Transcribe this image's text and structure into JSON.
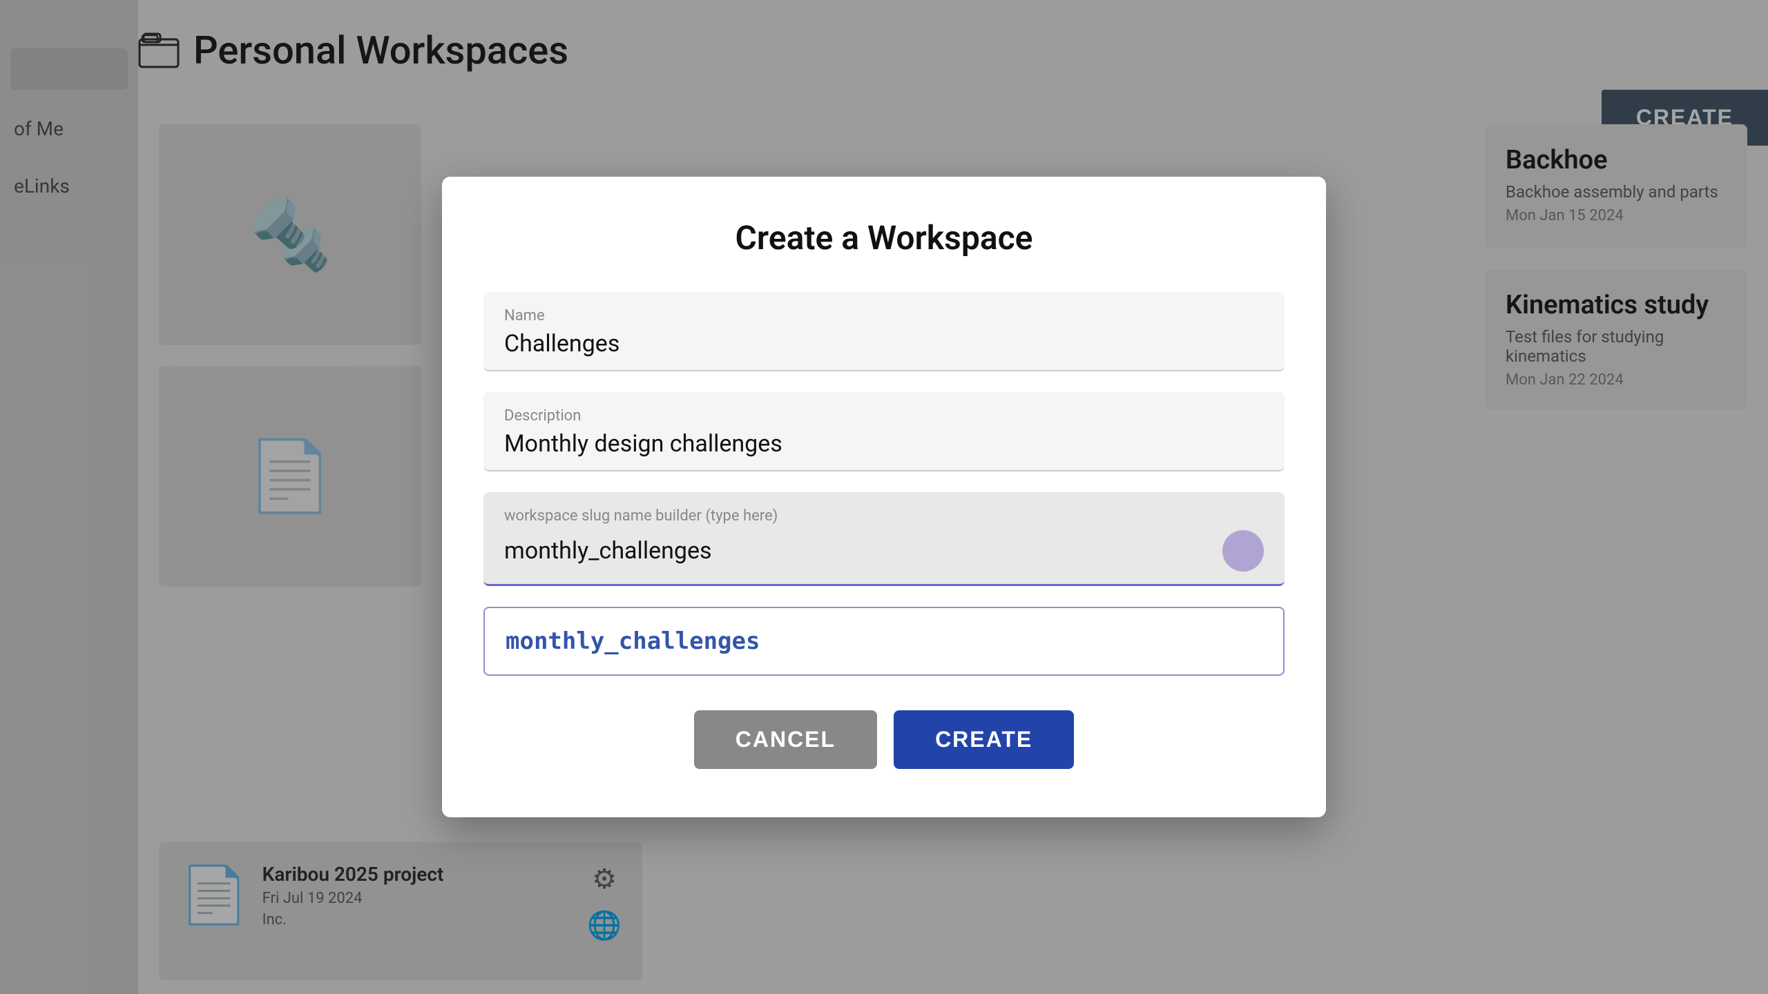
{
  "page": {
    "title": "Personal Workspaces",
    "create_button_label": "CREATE"
  },
  "sidebar": {
    "items": [
      {
        "id": "of-me",
        "label": "of Me"
      },
      {
        "id": "elinks",
        "label": "eLinks"
      }
    ]
  },
  "workspace_cards": [
    {
      "id": "backhoe",
      "title": "Backhoe",
      "description": "Backhoe assembly and parts",
      "date": "Mon Jan 15 2024",
      "has_3d": true
    },
    {
      "id": "kinematics",
      "title": "Kinematics study",
      "description": "Test files for studying kinematics",
      "date": "Mon Jan 22 2024",
      "has_3d": false
    }
  ],
  "bottom_card": {
    "title": "Karibou 2025 project",
    "date": "Fri Jul 19 2024",
    "company": "Inc."
  },
  "modal": {
    "title": "Create a Workspace",
    "name_label": "Name",
    "name_value": "Challenges",
    "description_label": "Description",
    "description_value": "Monthly design challenges",
    "slug_builder_label": "workspace slug name builder (type here)",
    "slug_builder_value": "monthly_challenges",
    "slug_preview_value": "monthly_challenges",
    "cancel_label": "CANCEL",
    "create_label": "CREATE"
  },
  "icons": {
    "workspace_folder": "🗂",
    "document": "📄",
    "gear": "⚙",
    "globe": "🌐",
    "part3d": "🔩"
  }
}
